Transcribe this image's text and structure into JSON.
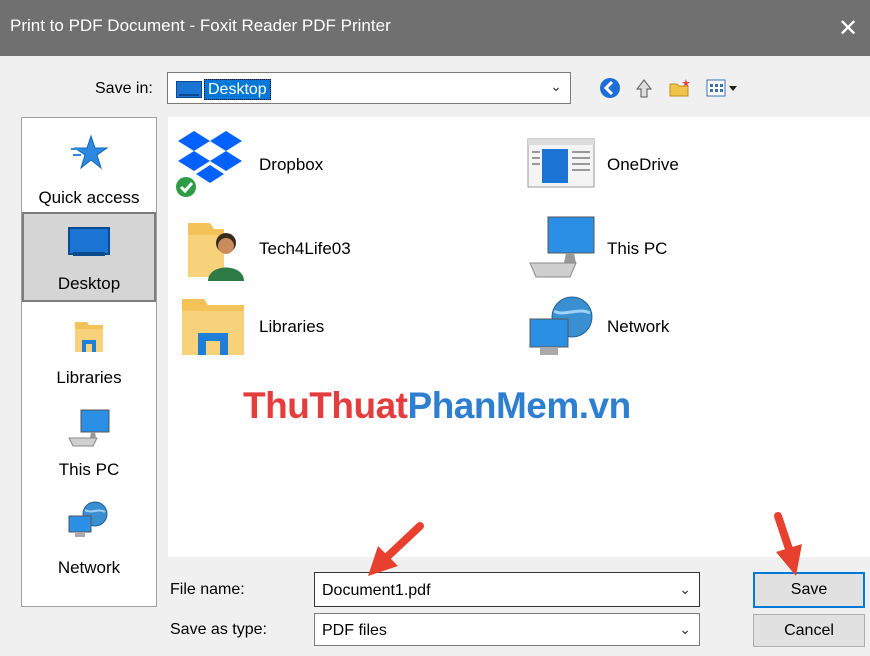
{
  "window": {
    "title": "Print to PDF Document - Foxit Reader PDF Printer",
    "close_glyph": "✕"
  },
  "toolbar": {
    "save_in_label": "Save in:",
    "save_in_value": "Desktop",
    "buttons": [
      "back-icon",
      "up-folder-icon",
      "new-folder-icon",
      "view-menu-icon"
    ]
  },
  "places": [
    {
      "label": "Quick access",
      "icon": "star-icon"
    },
    {
      "label": "Desktop",
      "icon": "desktop-icon",
      "selected": true
    },
    {
      "label": "Libraries",
      "icon": "libraries-icon"
    },
    {
      "label": "This PC",
      "icon": "computer-icon"
    },
    {
      "label": "Network",
      "icon": "network-icon"
    }
  ],
  "files": [
    {
      "label": "Dropbox",
      "icon": "dropbox-icon"
    },
    {
      "label": "OneDrive",
      "icon": "onedrive-icon"
    },
    {
      "label": "Tech4Life03",
      "icon": "user-folder-icon"
    },
    {
      "label": "This PC",
      "icon": "computer-icon"
    },
    {
      "label": "Libraries",
      "icon": "libraries-icon"
    },
    {
      "label": "Network",
      "icon": "network-icon"
    }
  ],
  "watermark": {
    "part1": "ThuThuat",
    "part2": "PhanMem",
    "part3": ".vn"
  },
  "form": {
    "file_name_label": "File name:",
    "file_name_value": "Document1.pdf",
    "save_as_type_label": "Save as type:",
    "save_as_type_value": "PDF files",
    "save_label": "Save",
    "cancel_label": "Cancel"
  },
  "colors": {
    "titlebar": "#707070",
    "accent": "#0078d7",
    "annotation_arrow": "#e8402e"
  }
}
